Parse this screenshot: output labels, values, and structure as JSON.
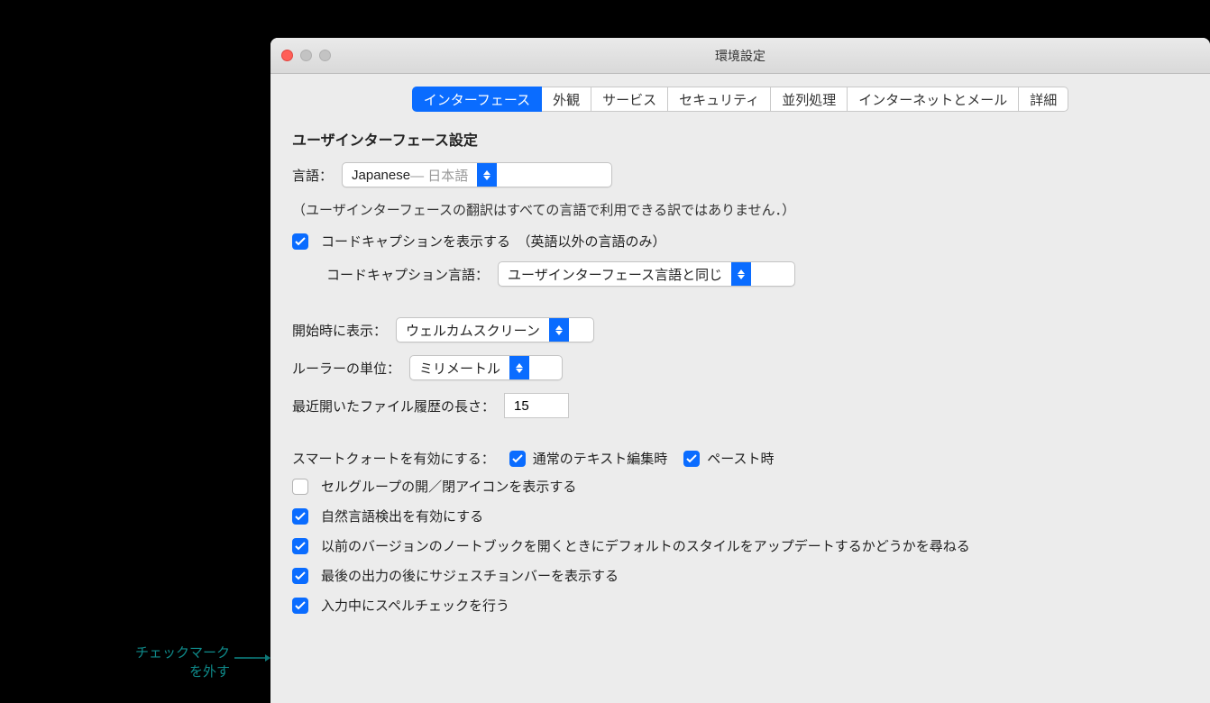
{
  "annotation": {
    "line1": "チェックマーク",
    "line2": "を外す"
  },
  "window": {
    "title": "環境設定",
    "tabs": [
      "インターフェース",
      "外観",
      "サービス",
      "セキュリティ",
      "並列処理",
      "インターネットとメール",
      "詳細"
    ]
  },
  "section": {
    "heading": "ユーザインターフェース設定",
    "language_label": "言語：",
    "language_value": "Japanese",
    "language_native": " — 日本語",
    "translation_note": "（ユーザインターフェースの翻訳はすべての言語で利用できる訳ではありません．）",
    "code_caption": "コードキャプションを表示する　（英語以外の言語のみ）",
    "code_caption_lang_label": "コードキャプション言語：",
    "code_caption_lang_value": "ユーザインターフェース言語と同じ",
    "startup_label": "開始時に表示：",
    "startup_value": "ウェルカムスクリーン",
    "ruler_label": "ルーラーの単位：",
    "ruler_value": "ミリメートル",
    "recent_label": "最近開いたファイル履歴の長さ：",
    "recent_value": "15",
    "smartquote_label": "スマートクォートを有効にする：",
    "smartquote_a": "通常のテキスト編集時",
    "smartquote_b": "ペースト時",
    "cell_group": "セルグループの開／閉アイコンを表示する",
    "nl_detect": "自然言語検出を有効にする",
    "update_style": "以前のバージョンのノートブックを開くときにデフォルトのスタイルをアップデートするかどうかを尋ねる",
    "suggestion_bar": "最後の出力の後にサジェスチョンバーを表示する",
    "spellcheck": "入力中にスペルチェックを行う"
  }
}
